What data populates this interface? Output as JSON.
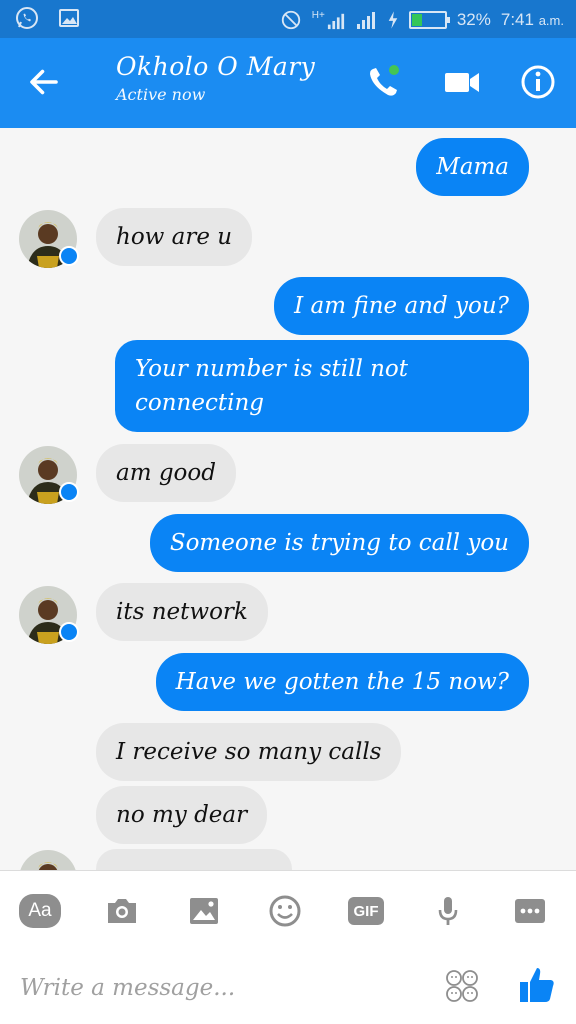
{
  "status_bar": {
    "network_label": "H+",
    "battery": "32%",
    "battery_level": 0.32,
    "time": "7:41",
    "ampm": "a.m.",
    "icons": [
      "whatsapp-icon",
      "gallery-icon",
      "do-not-disturb-icon",
      "signal-icon",
      "signal-icon",
      "charging-icon",
      "battery-icon"
    ]
  },
  "header": {
    "contact_name": "Okholo O Mary",
    "status": "Active now",
    "icons": [
      "back-arrow-icon",
      "phone-icon",
      "video-camera-icon",
      "info-icon"
    ],
    "colors": {
      "bar": "#1b8cf2",
      "status_bar": "#1877ce",
      "online_dot": "#44c553"
    }
  },
  "messages": [
    {
      "side": "out",
      "text": "Mama"
    },
    {
      "side": "in",
      "text": "how are u",
      "avatar": true
    },
    {
      "side": "out",
      "text": "I am fine and you?"
    },
    {
      "side": "out",
      "text": "Your number is still not connecting"
    },
    {
      "side": "in",
      "text": "am good",
      "avatar": true
    },
    {
      "side": "out",
      "text": "Someone is trying to call you"
    },
    {
      "side": "in",
      "text": "its network",
      "avatar": true
    },
    {
      "side": "out",
      "text": "Have we gotten the 15 now?"
    },
    {
      "side": "in",
      "text": "I receive so many calls"
    },
    {
      "side": "in",
      "text": "no my dear"
    }
  ],
  "colors": {
    "outgoing_bubble": "#0a84f5",
    "incoming_bubble": "#e7e7e7",
    "background": "#f6f6f6",
    "tool_icons": "#8e8e8e",
    "like": "#0a84f5"
  },
  "toolbar": {
    "aa_label": "Aa",
    "gif_label": "GIF",
    "icons": [
      "text-format-icon",
      "camera-icon",
      "image-icon",
      "emoji-icon",
      "gif-icon",
      "microphone-icon",
      "more-icon"
    ]
  },
  "composer": {
    "placeholder": "Write a message...",
    "icons": [
      "stickers-icon",
      "thumbs-up-icon"
    ]
  }
}
